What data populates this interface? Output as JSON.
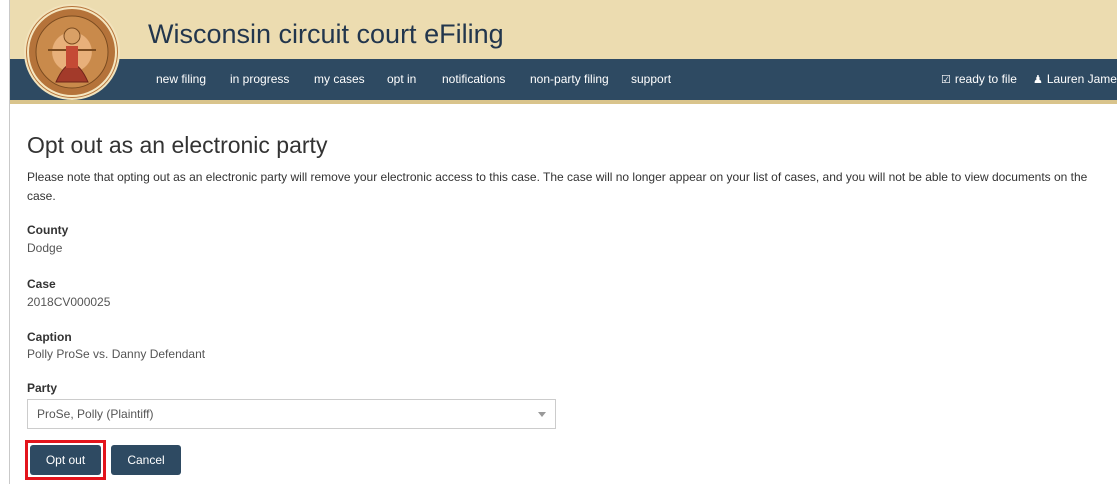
{
  "app": {
    "title": "Wisconsin circuit court eFiling"
  },
  "nav": {
    "items": [
      {
        "label": "new filing"
      },
      {
        "label": "in progress"
      },
      {
        "label": "my cases"
      },
      {
        "label": "opt in"
      },
      {
        "label": "notifications"
      },
      {
        "label": "non-party filing"
      },
      {
        "label": "support"
      }
    ],
    "ready_to_file": {
      "label": "ready to file",
      "icon": "check-square-icon"
    },
    "user": {
      "label": "Lauren James",
      "icon": "user-icon"
    }
  },
  "page": {
    "title": "Opt out as an electronic party",
    "notice": "Please note that opting out as an electronic party will remove your electronic access to this case. The case will no longer appear on your list of cases, and you will not be able to view documents on the case."
  },
  "fields": {
    "county": {
      "label": "County",
      "value": "Dodge"
    },
    "case": {
      "label": "Case",
      "value": "2018CV000025"
    },
    "caption": {
      "label": "Caption",
      "value": "Polly ProSe vs. Danny Defendant"
    },
    "party": {
      "label": "Party",
      "selected": "ProSe, Polly (Plaintiff)"
    }
  },
  "buttons": {
    "opt_out": "Opt out",
    "cancel": "Cancel"
  },
  "colors": {
    "header_bg": "#ecdcb0",
    "nav_bg": "#2e4a62",
    "title_text": "#22364d",
    "button_bg": "#2e4a62",
    "highlight": "#e3141c"
  }
}
